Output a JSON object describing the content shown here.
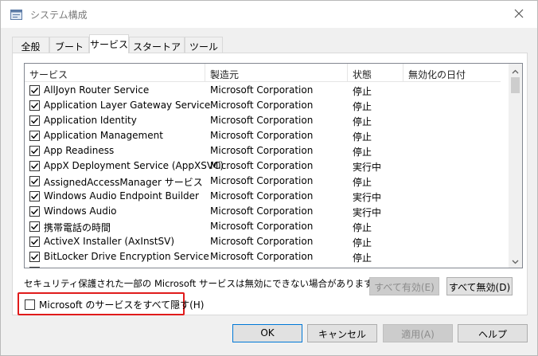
{
  "window": {
    "title": "システム構成"
  },
  "tabs": [
    {
      "label": "全般"
    },
    {
      "label": "ブート"
    },
    {
      "label": "サービス"
    },
    {
      "label": "スタートアップ"
    },
    {
      "label": "ツール"
    }
  ],
  "columns": {
    "service": "サービス",
    "manufacturer": "製造元",
    "status": "状態",
    "disabled_date": "無効化の日付"
  },
  "services": [
    {
      "name": "AllJoyn Router Service",
      "manufacturer": "Microsoft Corporation",
      "status": "停止",
      "checked": true
    },
    {
      "name": "Application Layer Gateway Service",
      "manufacturer": "Microsoft Corporation",
      "status": "停止",
      "checked": true
    },
    {
      "name": "Application Identity",
      "manufacturer": "Microsoft Corporation",
      "status": "停止",
      "checked": true
    },
    {
      "name": "Application Management",
      "manufacturer": "Microsoft Corporation",
      "status": "停止",
      "checked": true
    },
    {
      "name": "App Readiness",
      "manufacturer": "Microsoft Corporation",
      "status": "停止",
      "checked": true
    },
    {
      "name": "AppX Deployment Service (AppXSVC)",
      "manufacturer": "Microsoft Corporation",
      "status": "実行中",
      "checked": true
    },
    {
      "name": "AssignedAccessManager サービス",
      "manufacturer": "Microsoft Corporation",
      "status": "停止",
      "checked": true
    },
    {
      "name": "Windows Audio Endpoint Builder",
      "manufacturer": "Microsoft Corporation",
      "status": "実行中",
      "checked": true
    },
    {
      "name": "Windows Audio",
      "manufacturer": "Microsoft Corporation",
      "status": "実行中",
      "checked": true
    },
    {
      "name": "携帯電話の時間",
      "manufacturer": "Microsoft Corporation",
      "status": "停止",
      "checked": true
    },
    {
      "name": "ActiveX Installer (AxInstSV)",
      "manufacturer": "Microsoft Corporation",
      "status": "停止",
      "checked": true
    },
    {
      "name": "BitLocker Drive Encryption Service",
      "manufacturer": "Microsoft Corporation",
      "status": "停止",
      "checked": true
    },
    {
      "name": "",
      "manufacturer": "",
      "status": "",
      "checked": true
    }
  ],
  "notice": "セキュリティ保護された一部の Microsoft サービスは無効にできない場合があります。",
  "buttons": {
    "enable_all": "すべて有効(E)",
    "disable_all": "すべて無効(D)",
    "ok": "OK",
    "cancel": "キャンセル",
    "apply": "適用(A)",
    "help": "ヘルプ"
  },
  "hide_ms": {
    "label": "Microsoft のサービスをすべて隠す(H)",
    "checked": false
  },
  "icons": {
    "app": "system-config-icon",
    "close": "close-icon",
    "check": "check-icon",
    "scroll_up": "chevron-up-icon",
    "scroll_down": "chevron-down-icon"
  },
  "colors": {
    "highlight_border": "#e01b1b",
    "default_button_border": "#0078d7"
  }
}
